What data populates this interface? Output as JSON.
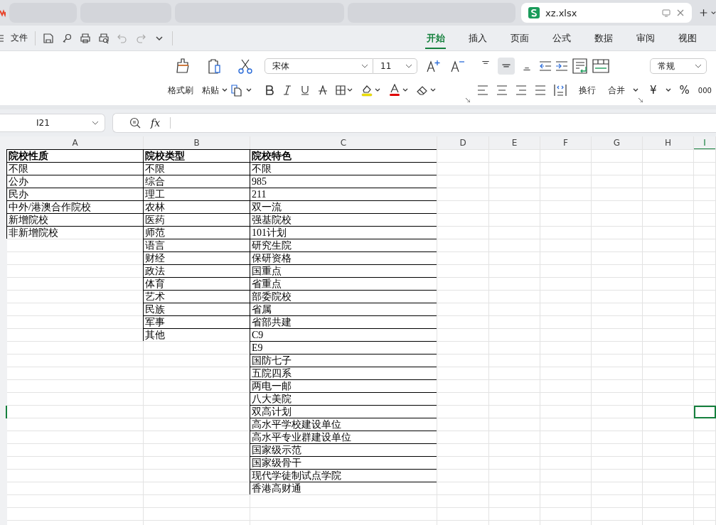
{
  "tabs": [
    {
      "kind": "blurred",
      "selected": false
    },
    {
      "kind": "blurred",
      "selected": false
    },
    {
      "kind": "blurred",
      "selected": false
    },
    {
      "kind": "blurred",
      "selected": false
    },
    {
      "kind": "file",
      "label": "xz.xlsx",
      "selected": true
    }
  ],
  "menu": {
    "file": "文件"
  },
  "ribbon_tabs": [
    {
      "label": "开始",
      "selected": true
    },
    {
      "label": "插入",
      "selected": false
    },
    {
      "label": "页面",
      "selected": false
    },
    {
      "label": "公式",
      "selected": false
    },
    {
      "label": "数据",
      "selected": false
    },
    {
      "label": "审阅",
      "selected": false
    },
    {
      "label": "视图",
      "selected": false
    }
  ],
  "ribbon": {
    "format_painter": "格式刷",
    "paste": "粘贴",
    "font_name": "宋体",
    "font_size": "11",
    "align_buttons": [
      {
        "kind": "top",
        "selected": false
      },
      {
        "kind": "middle",
        "selected": true
      },
      {
        "kind": "bottom",
        "selected": false
      }
    ],
    "wrap": "换行",
    "merge": "合并",
    "number_format": "常规",
    "currency": "¥",
    "percent": "%",
    "thousands": "000"
  },
  "formula_bar": {
    "name_box": "I21",
    "fx": "fx"
  },
  "sheet": {
    "columns": [
      {
        "header": "A",
        "selected": false,
        "cells": [
          "院校性质",
          "不限",
          "公办",
          "民办",
          "中外/港澳合作院校",
          "新增院校",
          "非新增院校"
        ]
      },
      {
        "header": "B",
        "selected": false,
        "cells": [
          "院校类型",
          "不限",
          "综合",
          "理工",
          "农林",
          "医药",
          "师范",
          "语言",
          "财经",
          "政法",
          "体育",
          "艺术",
          "民族",
          "军事",
          "其他"
        ]
      },
      {
        "header": "C",
        "selected": false,
        "cells": [
          "院校特色",
          "不限",
          "985",
          "211",
          "双一流",
          "强基院校",
          "101计划",
          "研究生院",
          "保研资格",
          "国重点",
          "省重点",
          "部委院校",
          "省属",
          "省部共建",
          "C9",
          "E9",
          "国防七子",
          "五院四系",
          "两电一邮",
          "八大美院",
          "双高计划",
          "高水平学校建设单位",
          "高水平专业群建设单位",
          "国家级示范",
          "国家级骨干",
          "现代学徒制试点学院",
          "香港高财通"
        ]
      },
      {
        "header": "D",
        "selected": false
      },
      {
        "header": "E",
        "selected": false
      },
      {
        "header": "F",
        "selected": false
      },
      {
        "header": "G",
        "selected": false
      },
      {
        "header": "H",
        "selected": false
      },
      {
        "header": "I",
        "selected": true
      }
    ]
  }
}
